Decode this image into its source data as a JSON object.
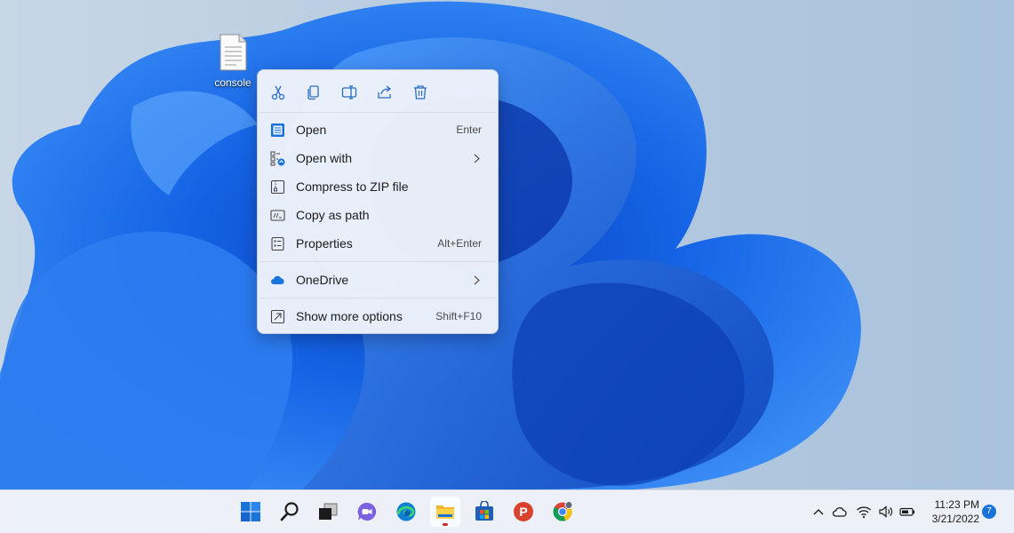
{
  "desktop": {
    "icon": {
      "label": "console",
      "icon": "text-file-icon"
    }
  },
  "context_menu": {
    "quick_actions": [
      {
        "name": "cut-icon"
      },
      {
        "name": "copy-icon"
      },
      {
        "name": "rename-icon"
      },
      {
        "name": "share-icon"
      },
      {
        "name": "delete-icon"
      }
    ],
    "items": [
      {
        "label": "Open",
        "shortcut": "Enter",
        "icon": "open-icon"
      },
      {
        "label": "Open with",
        "shortcut": "",
        "icon": "open-with-icon",
        "submenu": true
      },
      {
        "label": "Compress to ZIP file",
        "shortcut": "",
        "icon": "zip-icon"
      },
      {
        "label": "Copy as path",
        "shortcut": "",
        "icon": "copy-path-icon"
      },
      {
        "label": "Properties",
        "shortcut": "Alt+Enter",
        "icon": "properties-icon"
      },
      {
        "label": "OneDrive",
        "shortcut": "",
        "icon": "onedrive-icon",
        "submenu": true
      },
      {
        "label": "Show more options",
        "shortcut": "Shift+F10",
        "icon": "show-more-icon"
      }
    ]
  },
  "taskbar": {
    "apps": [
      {
        "name": "start-icon"
      },
      {
        "name": "search-icon"
      },
      {
        "name": "task-view-icon"
      },
      {
        "name": "chat-icon"
      },
      {
        "name": "edge-icon"
      },
      {
        "name": "file-explorer-icon",
        "active": true
      },
      {
        "name": "store-icon"
      },
      {
        "name": "app-p-icon",
        "letter": "P"
      },
      {
        "name": "chrome-icon"
      }
    ],
    "tray": {
      "icons": [
        "chevron-up-icon",
        "cloud-icon",
        "wifi-icon",
        "volume-icon",
        "battery-icon"
      ],
      "time": "11:23 PM",
      "date": "3/21/2022",
      "notification_count": "7"
    }
  },
  "colors": {
    "accent": "#1a73d9",
    "wallpaper_blue": "#1565e6",
    "menu_background": "#f0f4fa"
  }
}
